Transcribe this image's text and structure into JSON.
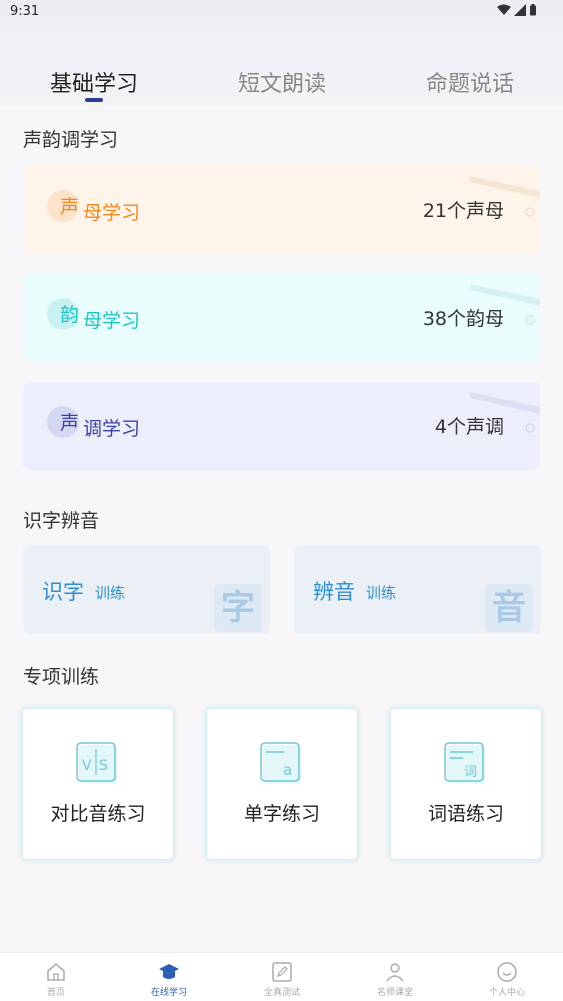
{
  "status": {
    "time": "9:31"
  },
  "tabs": [
    {
      "label": "基础学习",
      "active": true
    },
    {
      "label": "短文朗读",
      "active": false
    },
    {
      "label": "命题说话",
      "active": false
    }
  ],
  "sections": {
    "tones_title": "声韵调学习",
    "recognition_title": "识字辨音",
    "special_title": "专项训练"
  },
  "tone_cards": [
    {
      "first": "声",
      "rest": "母学习",
      "count": "21个声母",
      "bg": "#fff4e9",
      "accent": "#f08a1c",
      "badge": "#fde3c9"
    },
    {
      "first": "韵",
      "rest": "母学习",
      "count": "38个韵母",
      "bg": "#e9fdfd",
      "accent": "#1cc6c8",
      "badge": "#c9f1f2"
    },
    {
      "first": "声",
      "rest": "调学习",
      "count": "4个声调",
      "bg": "#eceefb",
      "accent": "#3a43a8",
      "badge": "#d5d8f3"
    }
  ],
  "training": [
    {
      "main": "识字",
      "sub": "训练",
      "bigchar": "字"
    },
    {
      "main": "辨音",
      "sub": "训练",
      "bigchar": "音"
    }
  ],
  "special": [
    {
      "label": "对比音练习",
      "icon": "vs-icon",
      "icon_text": "V|S"
    },
    {
      "label": "单字练习",
      "icon": "single-char-icon",
      "icon_text": "a"
    },
    {
      "label": "词语练习",
      "icon": "word-icon",
      "icon_text": "词"
    }
  ],
  "nav": [
    {
      "label": "首页",
      "icon": "home-icon",
      "active": false
    },
    {
      "label": "在线学习",
      "icon": "graduation-cap-icon",
      "active": true
    },
    {
      "label": "全真测试",
      "icon": "edit-icon",
      "active": false
    },
    {
      "label": "名师课堂",
      "icon": "teacher-icon",
      "active": false
    },
    {
      "label": "个人中心",
      "icon": "smile-icon",
      "active": false
    }
  ],
  "colors": {
    "primary": "#2b3f8f",
    "training_text": "#2e8ed4",
    "nav_active": "#2b5fb5"
  }
}
